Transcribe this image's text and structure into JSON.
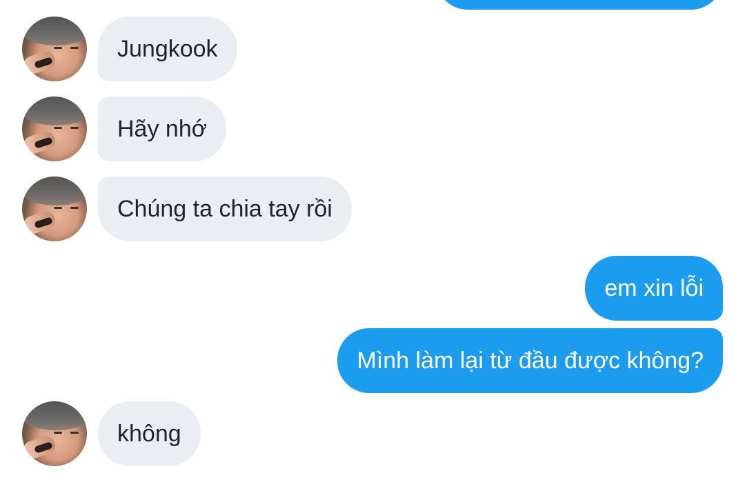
{
  "conversation": {
    "messages": [
      {
        "sender": "contact",
        "text": "Jungkook"
      },
      {
        "sender": "contact",
        "text": "Hãy nhớ"
      },
      {
        "sender": "contact",
        "text": "Chúng ta chia tay rồi"
      },
      {
        "sender": "me",
        "text": "em xin lỗi"
      },
      {
        "sender": "me",
        "text": "Mình làm lại từ đầu được không?"
      },
      {
        "sender": "contact",
        "text": "không"
      }
    ]
  },
  "colors": {
    "incoming_bubble": "#eaedf1",
    "outgoing_bubble": "#1c9cef",
    "incoming_text": "#1f2429",
    "outgoing_text": "#ffffff",
    "background": "#ffffff"
  },
  "icons": {
    "contact_avatar": "contact-avatar-photo"
  }
}
